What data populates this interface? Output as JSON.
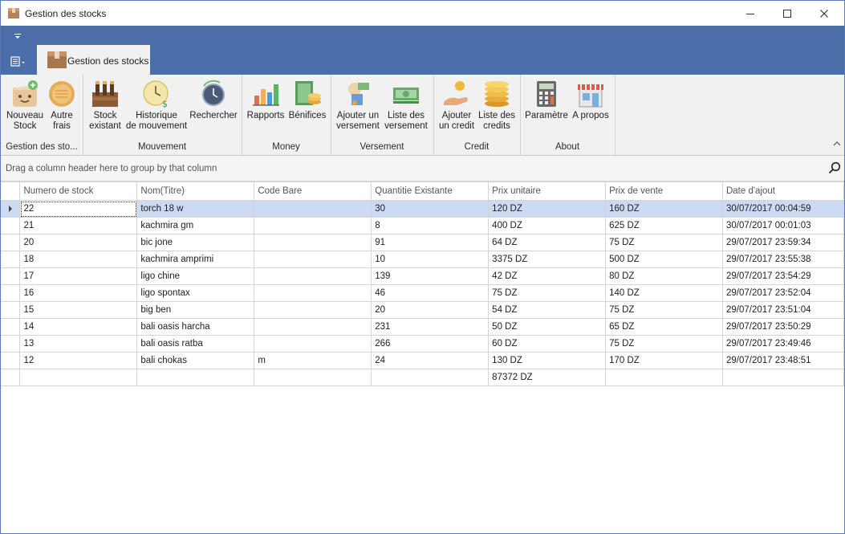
{
  "window": {
    "title": "Gestion des stocks"
  },
  "tab": {
    "label": "Gestion des stocks"
  },
  "ribbon": {
    "groups": [
      {
        "caption": "Gestion des sto...",
        "buttons": [
          {
            "line1": "Nouveau",
            "line2": "Stock",
            "icon": "new-stock-icon"
          },
          {
            "line1": "Autre",
            "line2": "frais",
            "icon": "coin-icon"
          }
        ]
      },
      {
        "caption": "Mouvement",
        "buttons": [
          {
            "line1": "Stock",
            "line2": "existant",
            "icon": "bottles-icon"
          },
          {
            "line1": "Historique",
            "line2": "de mouvement",
            "icon": "clock-icon"
          },
          {
            "line1": "Rechercher",
            "line2": "",
            "icon": "search-clock-icon"
          }
        ]
      },
      {
        "caption": "Money",
        "buttons": [
          {
            "line1": "Rapports",
            "line2": "",
            "icon": "bar-chart-icon"
          },
          {
            "line1": "Bénifices",
            "line2": "",
            "icon": "money-icon"
          }
        ]
      },
      {
        "caption": "Versement",
        "buttons": [
          {
            "line1": "Ajouter un",
            "line2": "versement",
            "icon": "deposit-icon"
          },
          {
            "line1": "Liste des",
            "line2": "versement",
            "icon": "banknotes-icon"
          }
        ]
      },
      {
        "caption": "Credit",
        "buttons": [
          {
            "line1": "Ajouter",
            "line2": "un credit",
            "icon": "hand-coin-icon"
          },
          {
            "line1": "Liste des",
            "line2": "credits",
            "icon": "coin-stack-icon"
          }
        ]
      },
      {
        "caption": "About",
        "buttons": [
          {
            "line1": "Paramètre",
            "line2": "",
            "icon": "calculator-icon"
          },
          {
            "line1": "A propos",
            "line2": "",
            "icon": "shop-icon"
          }
        ]
      }
    ]
  },
  "group_panel": {
    "text": "Drag a column header here to group by that column"
  },
  "grid": {
    "columns": [
      "Numero de stock",
      "Nom(Titre)",
      "Code Bare",
      "Quantitie Existante",
      "Prix unitaire",
      "Prix de vente",
      "Date d'ajout"
    ],
    "rows": [
      [
        "22",
        "torch 18 w",
        "",
        "30",
        "120 DZ",
        "160 DZ",
        "30/07/2017 00:04:59"
      ],
      [
        "21",
        "kachmira gm",
        "",
        "8",
        "400 DZ",
        "625 DZ",
        "30/07/2017 00:01:03"
      ],
      [
        "20",
        "bic jone",
        "",
        "91",
        "64 DZ",
        "75 DZ",
        "29/07/2017 23:59:34"
      ],
      [
        "18",
        "kachmira amprimi",
        "",
        "10",
        "3375 DZ",
        "500 DZ",
        "29/07/2017 23:55:38"
      ],
      [
        "17",
        "ligo chine",
        "",
        "139",
        "42 DZ",
        "80 DZ",
        "29/07/2017 23:54:29"
      ],
      [
        "16",
        "ligo spontax",
        "",
        "46",
        "75 DZ",
        "140 DZ",
        "29/07/2017 23:52:04"
      ],
      [
        "15",
        "big ben",
        "",
        "20",
        "54 DZ",
        "75 DZ",
        "29/07/2017 23:51:04"
      ],
      [
        "14",
        "bali oasis harcha",
        "",
        "231",
        "50 DZ",
        "65 DZ",
        "29/07/2017 23:50:29"
      ],
      [
        "13",
        "bali oasis ratba",
        "",
        "266",
        "60 DZ",
        "75 DZ",
        "29/07/2017 23:49:46"
      ],
      [
        "12",
        "bali chokas",
        "m",
        "24",
        "130 DZ",
        "170 DZ",
        "29/07/2017 23:48:51"
      ]
    ],
    "selected_row": 0,
    "footer": {
      "prix_unitaire_total": "87372 DZ"
    }
  }
}
